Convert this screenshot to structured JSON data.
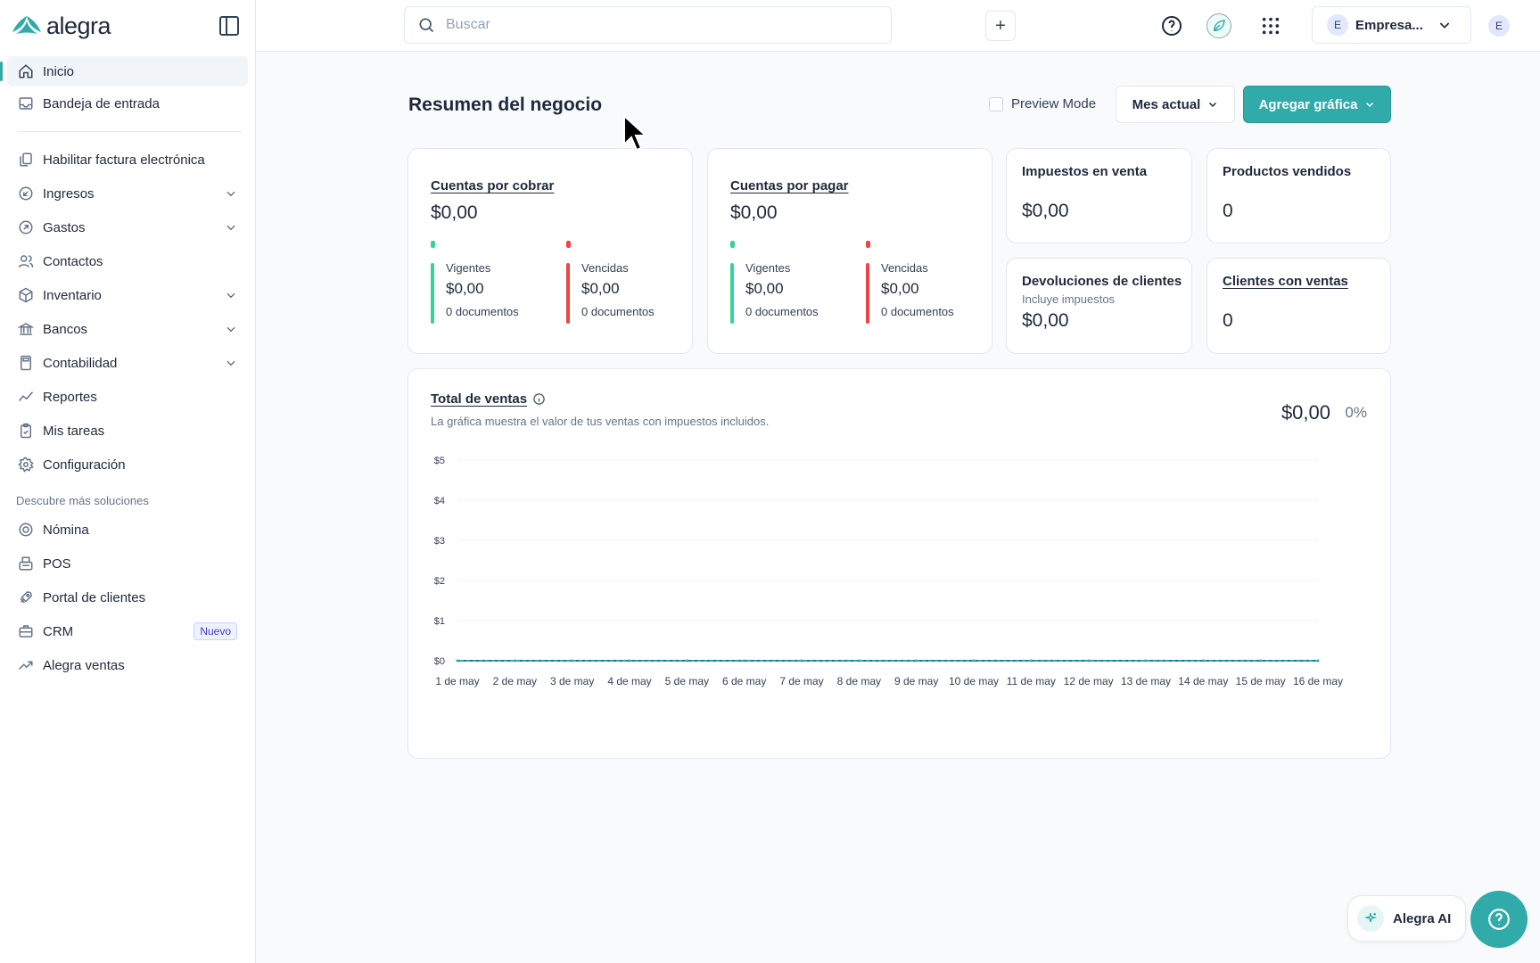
{
  "app": {
    "logo_text": "alegra"
  },
  "sidebar": {
    "items": [
      {
        "label": "Inicio",
        "icon": "home-icon"
      },
      {
        "label": "Bandeja de entrada",
        "icon": "inbox-icon"
      },
      {
        "label": "Habilitar factura electrónica",
        "icon": "copy-icon"
      },
      {
        "label": "Ingresos",
        "icon": "arrow-in-icon"
      },
      {
        "label": "Gastos",
        "icon": "arrow-out-icon"
      },
      {
        "label": "Contactos",
        "icon": "contacts-icon"
      },
      {
        "label": "Inventario",
        "icon": "box-icon"
      },
      {
        "label": "Bancos",
        "icon": "bank-icon"
      },
      {
        "label": "Contabilidad",
        "icon": "calculator-icon"
      },
      {
        "label": "Reportes",
        "icon": "trend-icon"
      },
      {
        "label": "Mis tareas",
        "icon": "clipboard-icon"
      },
      {
        "label": "Configuración",
        "icon": "gear-icon"
      }
    ],
    "section_title": "Descubre más soluciones",
    "solutions": [
      {
        "label": "Nómina",
        "icon": "payroll-icon"
      },
      {
        "label": "POS",
        "icon": "pos-icon"
      },
      {
        "label": "Portal de clientes",
        "icon": "rocket-icon"
      },
      {
        "label": "CRM",
        "icon": "briefcase-icon",
        "badge": "Nuevo"
      },
      {
        "label": "Alegra ventas",
        "icon": "trend-up-icon"
      }
    ]
  },
  "topbar": {
    "search_placeholder": "Buscar",
    "plus_label": "+",
    "company_initial": "E",
    "company_name": "Empresa...",
    "user_initial": "E"
  },
  "main": {
    "title": "Resumen del negocio",
    "preview_mode": "Preview Mode",
    "period": "Mes actual",
    "add_chart": "Agregar gráfica",
    "cobrar": {
      "title": "Cuentas por cobrar",
      "value": "$0,00",
      "vigentes_label": "Vigentes",
      "vigentes_value": "$0,00",
      "vigentes_docs": "0 documentos",
      "vencidas_label": "Vencidas",
      "vencidas_value": "$0,00",
      "vencidas_docs": "0 documentos"
    },
    "pagar": {
      "title": "Cuentas por pagar",
      "value": "$0,00",
      "vigentes_label": "Vigentes",
      "vigentes_value": "$0,00",
      "vigentes_docs": "0 documentos",
      "vencidas_label": "Vencidas",
      "vencidas_value": "$0,00",
      "vencidas_docs": "0 documentos"
    },
    "impuestos": {
      "title": "Impuestos en venta",
      "value": "$0,00"
    },
    "productos": {
      "title": "Productos vendidos",
      "value": "0"
    },
    "devoluciones": {
      "title": "Devoluciones de clientes",
      "subtitle": "Incluye impuestos",
      "value": "$0,00"
    },
    "clientes": {
      "title": "Clientes con ventas",
      "value": "0"
    },
    "ventas": {
      "title": "Total de ventas",
      "description": "La gráfica muestra el valor de tus ventas con impuestos incluidos.",
      "total": "$0,00",
      "percent": "0%"
    },
    "ai_label": "Alegra AI"
  },
  "colors": {
    "accent": "#30aba9",
    "vigente": "#34d399",
    "vencida": "#ef4444"
  },
  "chart_data": {
    "type": "line",
    "title": "Total de ventas",
    "categories": [
      "1 de may",
      "2 de may",
      "3 de may",
      "4 de may",
      "5 de may",
      "6 de may",
      "7 de may",
      "8 de may",
      "9 de may",
      "10 de may",
      "11 de may",
      "12 de may",
      "13 de may",
      "14 de may",
      "15 de may",
      "16 de may"
    ],
    "series": [
      {
        "values": [
          0,
          0,
          0,
          0,
          0,
          0,
          0,
          0,
          0,
          0,
          0,
          0,
          0,
          0,
          0,
          0
        ]
      }
    ],
    "y_ticks": [
      "$0",
      "$1",
      "$2",
      "$3",
      "$4",
      "$5"
    ],
    "ylim": [
      0,
      5
    ],
    "grid": true
  }
}
